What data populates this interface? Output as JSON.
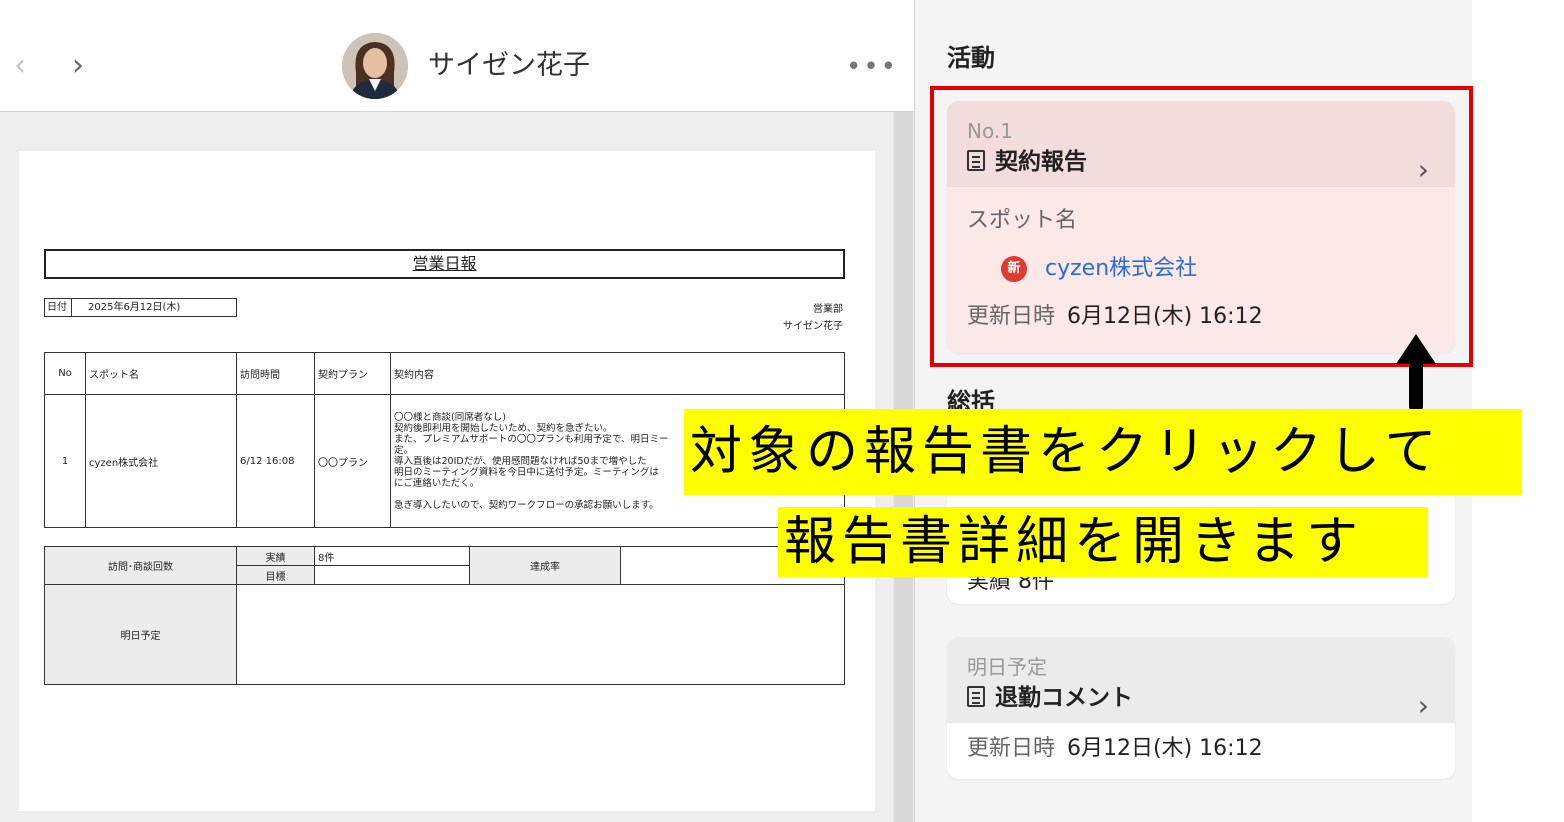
{
  "header": {
    "prev_label": "‹",
    "next_label": "›",
    "user_name": "サイゼン花子",
    "more_label": "•••"
  },
  "document": {
    "title": "営業日報",
    "date_label": "日付",
    "date_value": "2025年6月12日(木)",
    "department": "営業部",
    "author": "サイゼン花子",
    "table_headers": [
      "No",
      "スポット名",
      "訪問時間",
      "契約プラン",
      "契約内容"
    ],
    "row": {
      "no": "1",
      "spot": "cyzen株式会社",
      "time": "6/12 16:08",
      "plan": "〇〇プラン",
      "content_lines": [
        "〇〇様と商談(同席者なし)",
        "契約後即利用を開始したいため、契約を急ぎたい。",
        "また、プレミアムサポートの〇〇プランも利用予定で、明日ミー",
        "定。",
        "導入直後は20IDだが、使用感問題なければ50まで増やした",
        "明日のミーティング資料を今日中に送付予定。ミーティングは",
        "にご連絡いただく。",
        "",
        "急ぎ導入したいので、契約ワークフローの承認お願いします。"
      ]
    },
    "summary": {
      "visits_label": "訪問･商談回数",
      "actual_label": "実績",
      "actual_value": "8件",
      "target_label": "目標",
      "rate_label": "達成率",
      "tomorrow_label": "明日予定"
    }
  },
  "right": {
    "activity_title": "活動",
    "summary_title": "総括",
    "card1": {
      "label": "No.1",
      "name": "契約報告",
      "spot_label": "スポット名",
      "new_badge": "新",
      "spot_name": "cyzen株式会社",
      "updated_label": "更新日時",
      "updated_value": "6月12日(木) 16:12"
    },
    "card2": {
      "partial_text": "実績 8件"
    },
    "card3": {
      "label": "明日予定",
      "name": "退勤コメント",
      "updated_label": "更新日時",
      "updated_value": "6月12日(木) 16:12"
    }
  },
  "annotation": {
    "line1": "対象の報告書をクリックして",
    "line2": "報告書詳細を開きます"
  },
  "colors": {
    "highlight": "#e30000",
    "callout_bg": "#ffff00",
    "link": "#2a6bd6"
  }
}
